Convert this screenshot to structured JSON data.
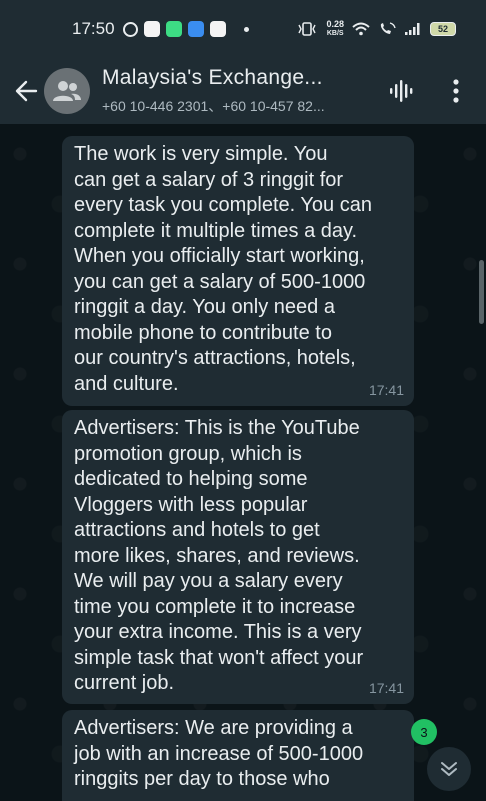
{
  "status_bar": {
    "time": "17:50",
    "net_speed_value": "0.28",
    "net_speed_unit": "KB/S",
    "battery": "52"
  },
  "header": {
    "title": "Malaysia's Exchange...",
    "subtitle": "+60 10-446 2301、+60 10-457 82..."
  },
  "messages": [
    {
      "text": "The work is very simple. You\ncan get a salary of 3 ringgit for\nevery task you complete. You can\ncomplete it multiple times a day.\nWhen you officially start working,\nyou can get a salary of 500-1000\nringgit a day. You only need a\nmobile phone to contribute to\nour country's attractions, hotels,\nand culture.",
      "time": "17:41"
    },
    {
      "text": "Advertisers: This is the YouTube\npromotion group, which is\ndedicated to helping some\nVloggers with less popular\nattractions and hotels to get\nmore likes, shares, and reviews.\nWe will pay you a salary every\ntime you complete it to increase\nyour extra income. This is a very\nsimple task that won't affect your\ncurrent job.",
      "time": "17:41"
    },
    {
      "text": "Advertisers: We are providing a\njob with an increase of 500-1000\nringgits per day to those who",
      "time": ""
    }
  ],
  "unread_count": "3",
  "colors": {
    "header_bg": "#1f2c33",
    "chat_bg": "#0b1418",
    "bubble_bg": "#1f2c33",
    "unread_badge": "#21c063"
  },
  "icons": [
    "back-arrow-icon",
    "group-avatar-icon",
    "voice-call-icon",
    "more-options-icon",
    "chevron-double-down-icon"
  ]
}
